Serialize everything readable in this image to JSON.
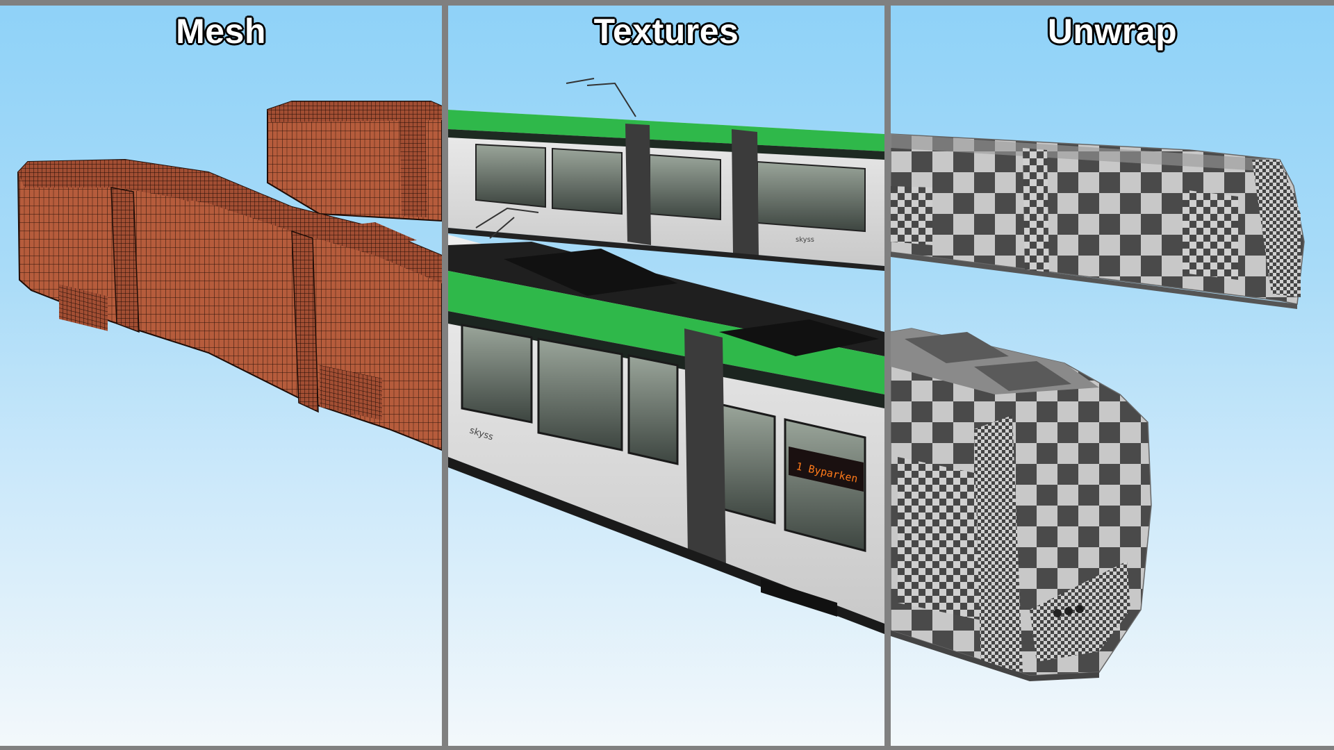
{
  "panels": [
    {
      "title": "Mesh"
    },
    {
      "title": "Textures"
    },
    {
      "title": "Unwrap"
    }
  ],
  "tram": {
    "brand_text": "skyss",
    "destination_text": "1  Byparken"
  },
  "colors": {
    "mesh_body": "#b0583a",
    "mesh_lines": "#2a120a",
    "tram_green": "#2fb84a",
    "tram_white": "#e2e2e2",
    "tram_dark": "#3b3b3b",
    "checker_light": "#c8c8c8",
    "checker_dark": "#4a4a4a",
    "divider": "#808080"
  }
}
